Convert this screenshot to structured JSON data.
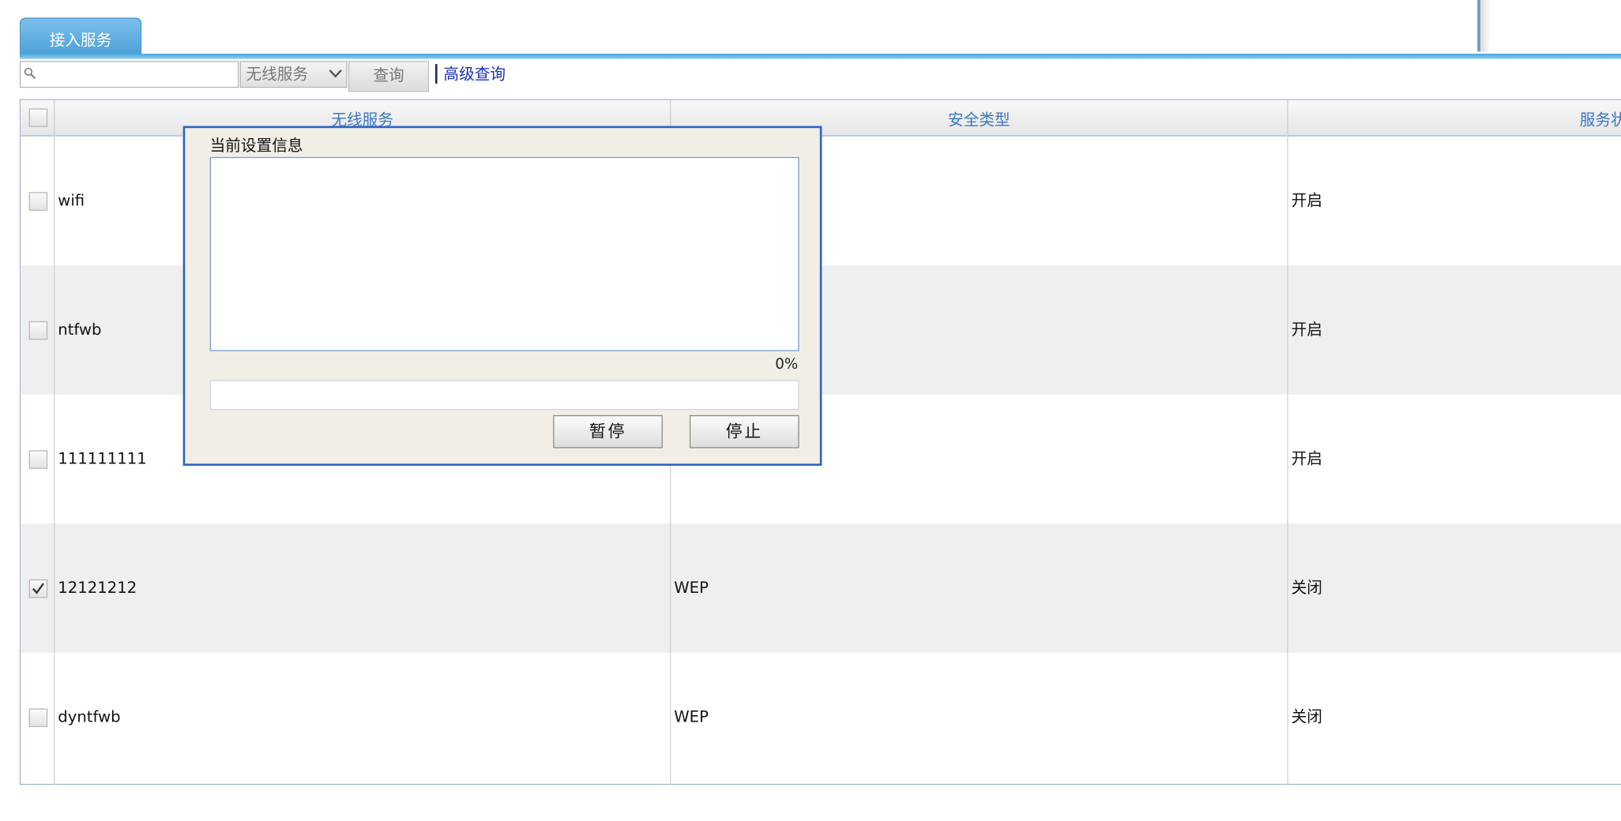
{
  "tab": {
    "label": "接入服务"
  },
  "toolbar": {
    "search_value": "",
    "filter_selected": "无线服务",
    "query_label": "查询",
    "advanced_label": "高级查询"
  },
  "table": {
    "headers": [
      "无线服务",
      "安全类型",
      "服务状"
    ],
    "rows": [
      {
        "name": "wifi",
        "security": "",
        "status": "开启",
        "checked": false
      },
      {
        "name": "ntfwb",
        "security": "",
        "status": "开启",
        "checked": false
      },
      {
        "name": "111111111",
        "security": "",
        "status": "开启",
        "checked": false
      },
      {
        "name": "12121212",
        "security": "WEP",
        "status": "关闭",
        "checked": true
      },
      {
        "name": "dyntfwb",
        "security": "WEP",
        "status": "关闭",
        "checked": false
      }
    ]
  },
  "dialog": {
    "title": "当前设置信息",
    "log_text": "",
    "progress_text": "0%",
    "progress_value": 0,
    "pause_label": "暂停",
    "stop_label": "停止"
  },
  "colors": {
    "tab": "#4a9fd6",
    "header_text": "#3a77c2",
    "link": "#1b31b6",
    "dialog_border": "#2d64c4",
    "dialog_bg": "#f1efe5",
    "alt_row": "#eef0ee"
  }
}
